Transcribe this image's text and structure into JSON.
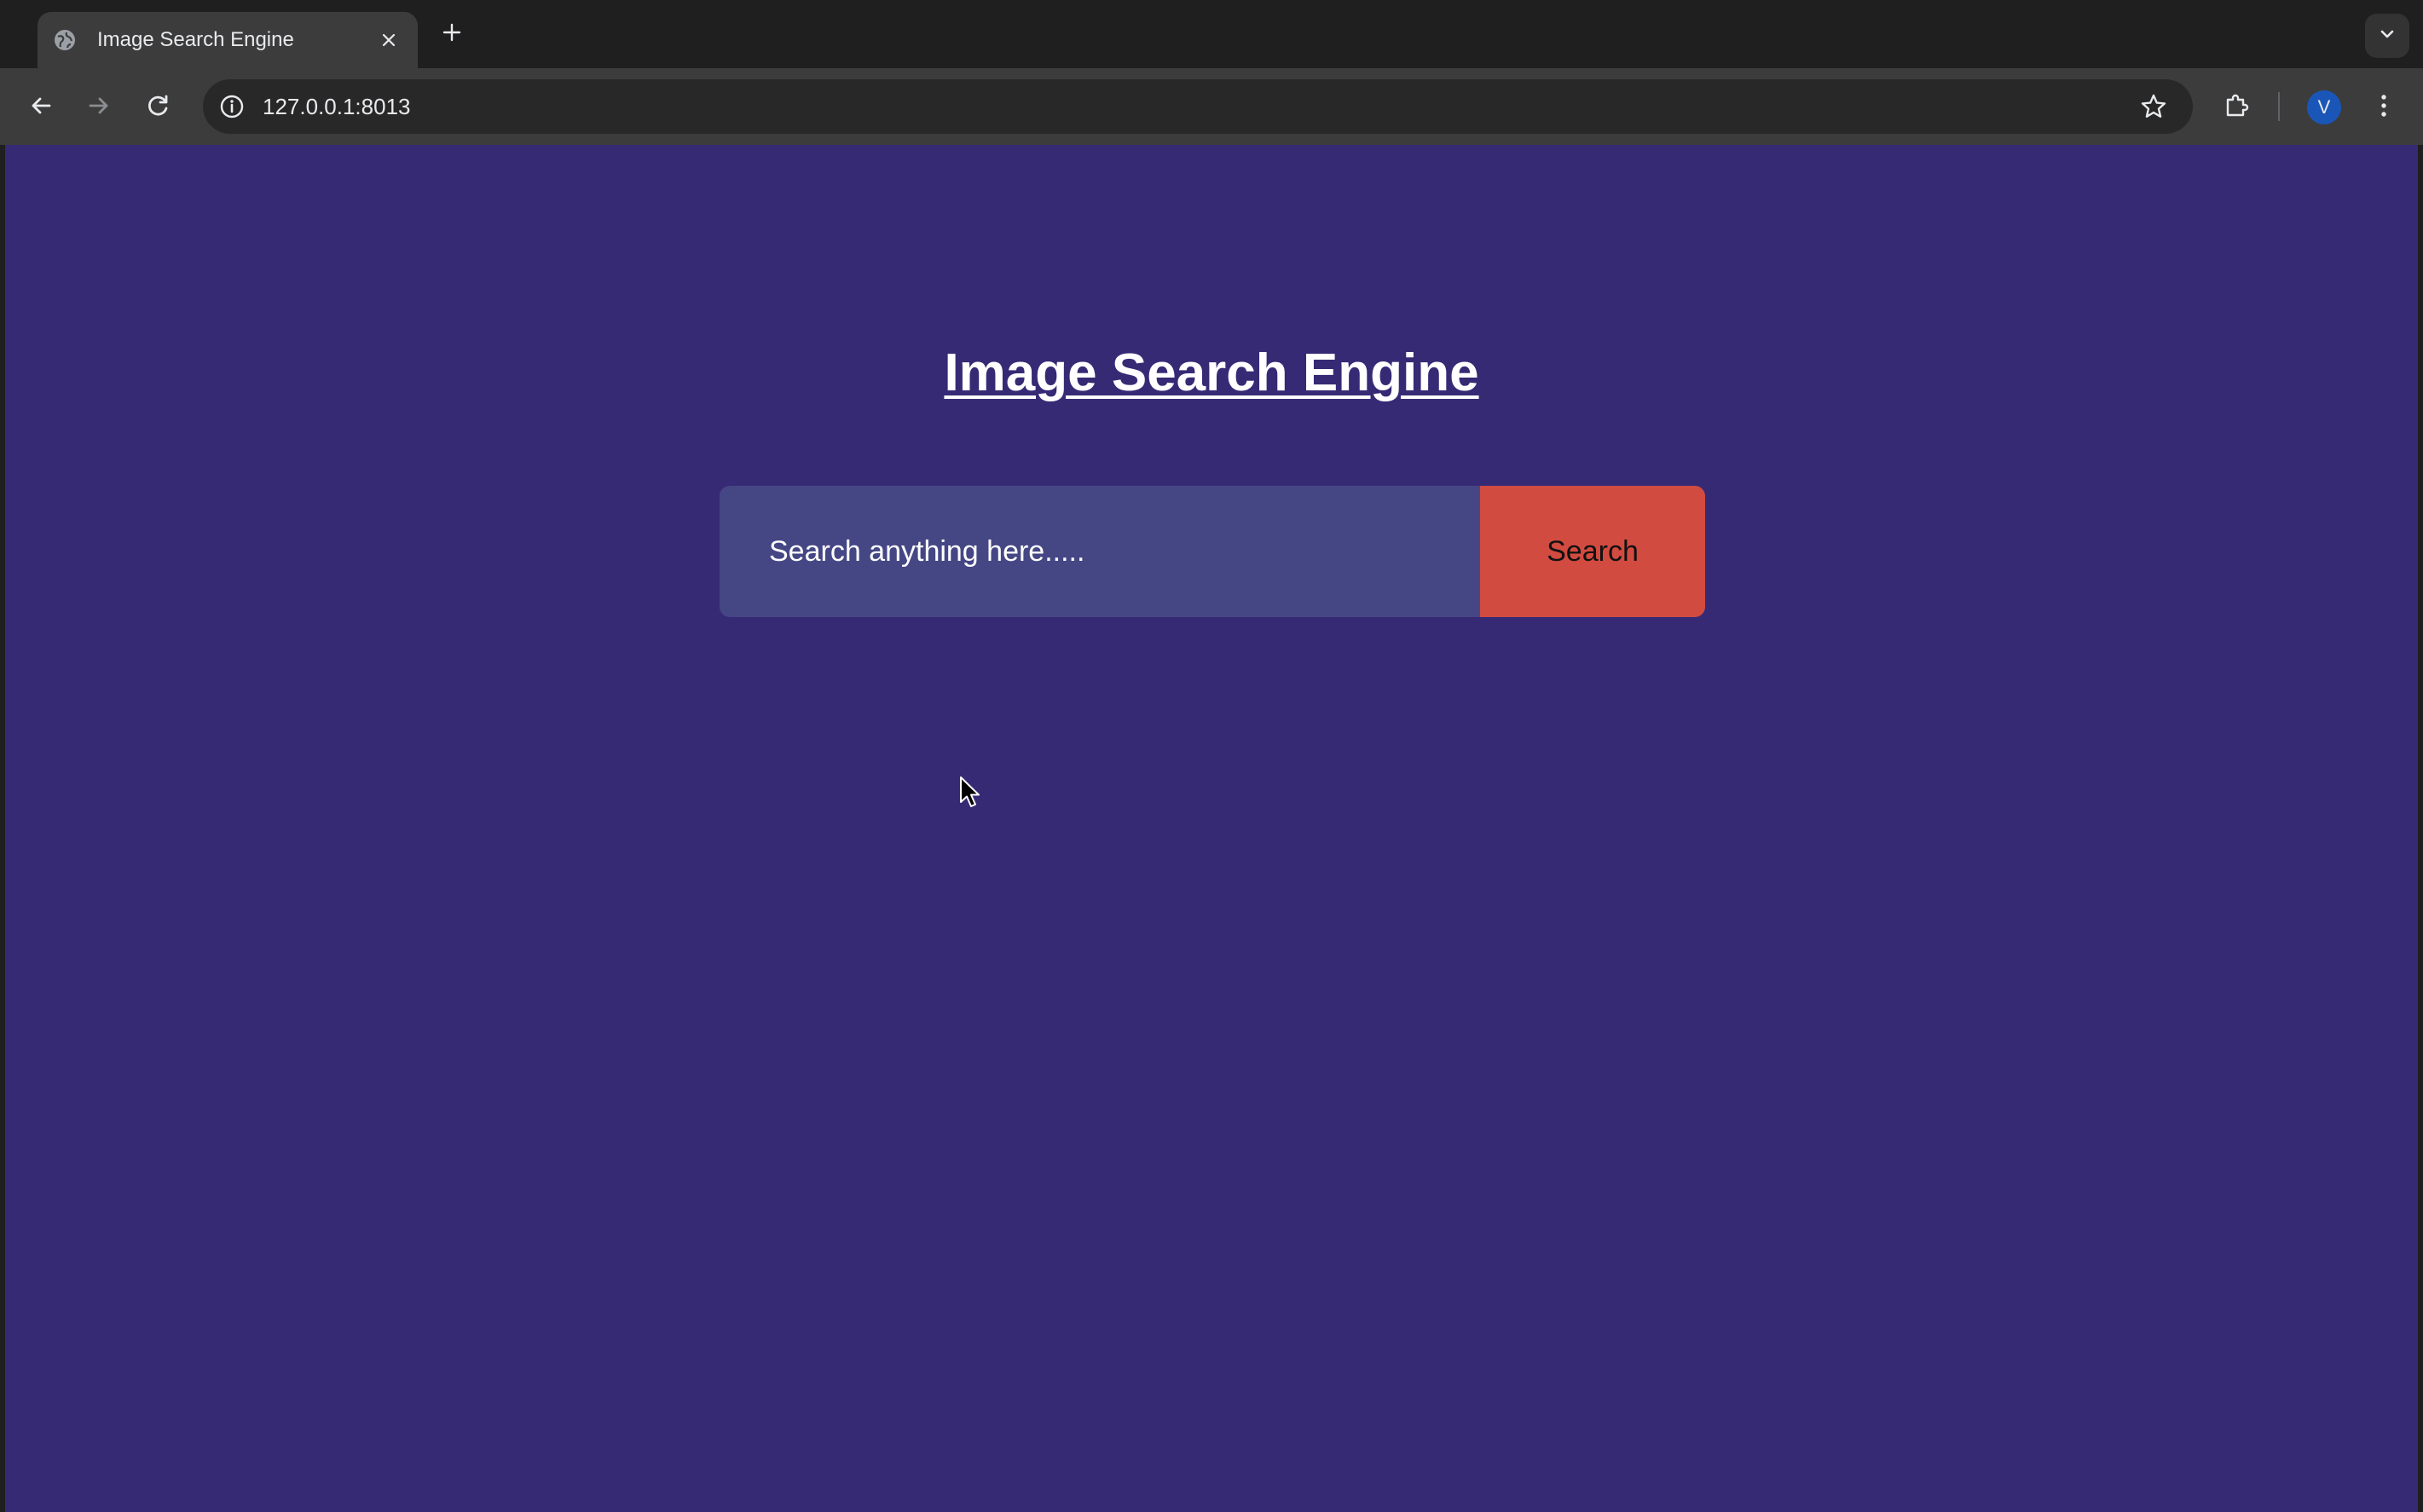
{
  "browser": {
    "tab": {
      "title": "Image Search Engine"
    },
    "address_bar": {
      "url": "127.0.0.1:8013"
    },
    "profile": {
      "initial": "V",
      "color": "#1a56b8"
    },
    "icons": {
      "favicon": "globe-icon",
      "close": "close-icon",
      "new_tab": "plus-icon",
      "tab_search": "chevron-down-icon",
      "back": "back-arrow-icon",
      "forward": "forward-arrow-icon",
      "reload": "reload-icon",
      "site_info": "info-icon",
      "bookmark": "star-icon",
      "extensions": "puzzle-icon",
      "menu": "kebab-menu-icon"
    }
  },
  "page": {
    "title": "Image Search Engine",
    "search": {
      "placeholder": "Search anything here.....",
      "value": "",
      "button_label": "Search"
    },
    "colors": {
      "background": "#372a75",
      "input_background": "#454785",
      "button_background": "#d24b40"
    }
  }
}
